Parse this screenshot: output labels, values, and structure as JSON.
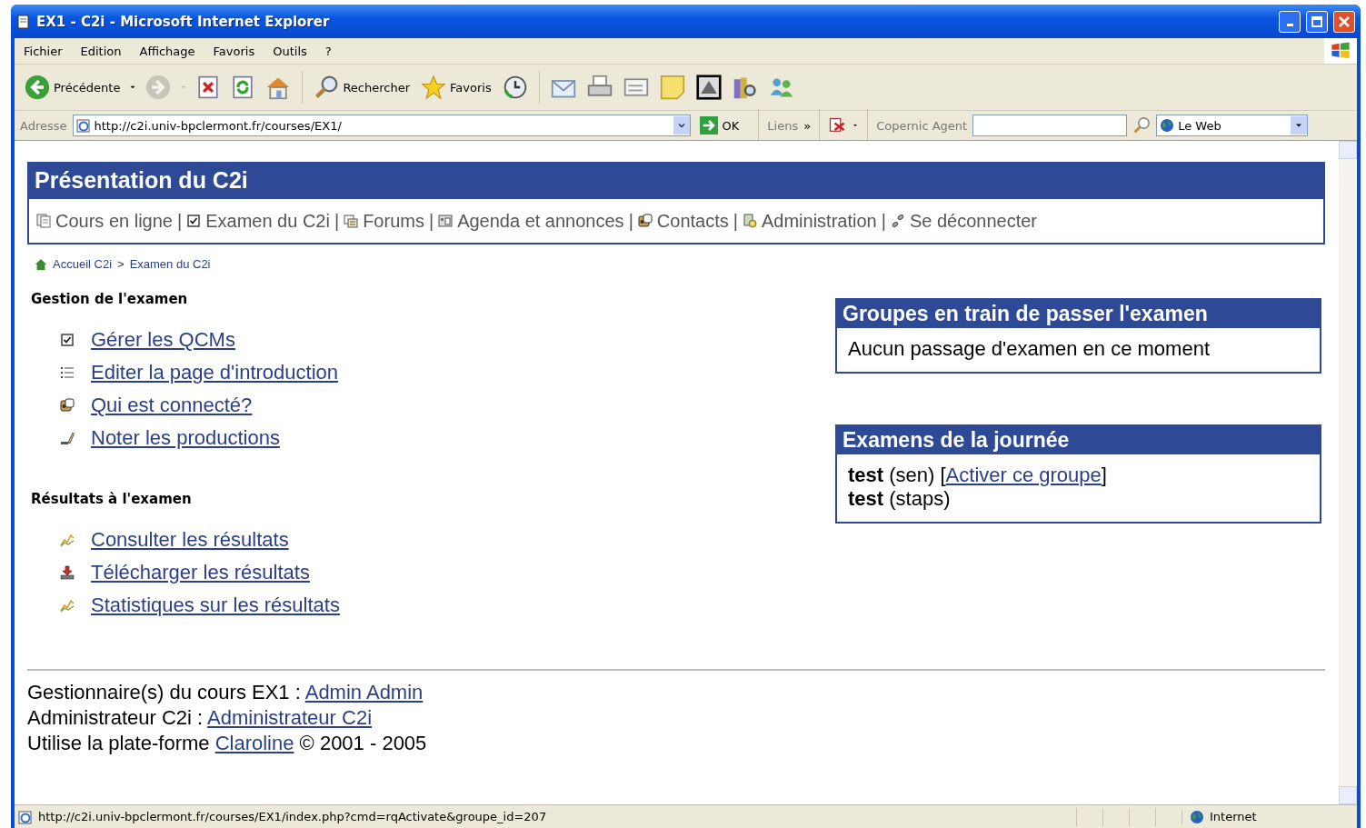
{
  "window": {
    "title": "EX1 - C2i - Microsoft Internet Explorer"
  },
  "menu": [
    "Fichier",
    "Edition",
    "Affichage",
    "Favoris",
    "Outils",
    "?"
  ],
  "toolbar": {
    "back_label": "Précédente",
    "forward": {
      "disabled": true
    },
    "search_label": "Rechercher",
    "favorites_label": "Favoris"
  },
  "address_bar": {
    "label": "Adresse",
    "url": "http://c2i.univ-bpclermont.fr/courses/EX1/",
    "go_label": "OK",
    "links_label": "Liens",
    "links_more": "»",
    "search_toolbar_label": "Copernic Agent",
    "search_scope": "Le Web"
  },
  "page": {
    "title": "Présentation du C2i",
    "separator": "|",
    "nav": [
      {
        "label": "Cours en ligne"
      },
      {
        "label": "Examen du C2i"
      },
      {
        "label": "Forums"
      },
      {
        "label": "Agenda et annonces"
      },
      {
        "label": "Contacts"
      },
      {
        "label": "Administration"
      },
      {
        "label": "Se déconnecter"
      }
    ],
    "breadcrumb": [
      {
        "label": "Accueil C2i"
      },
      {
        "label": "Examen du C2i"
      }
    ],
    "breadcrumb_separator": ">",
    "sections": [
      {
        "title": "Gestion de l'examen",
        "items": [
          {
            "label": "Gérer les QCMs"
          },
          {
            "label": "Editer la page d'introduction"
          },
          {
            "label": "Qui est connecté?"
          },
          {
            "label": "Noter les productions"
          }
        ]
      },
      {
        "title": "Résultats à l'examen",
        "items": [
          {
            "label": "Consulter les résultats"
          },
          {
            "label": "Télécharger les résultats"
          },
          {
            "label": "Statistiques sur les résultats"
          }
        ]
      }
    ],
    "panels": [
      {
        "kind": "message",
        "title": "Groupes en train de passer l'examen",
        "message": "Aucun passage d'examen en ce moment"
      },
      {
        "kind": "rows",
        "title": "Examens de la journée",
        "rows": [
          {
            "text": "**test** (sen) [",
            "link": "Activer ce groupe",
            "after": "]"
          },
          {
            "text": "**test** (staps)"
          }
        ]
      }
    ],
    "footer": [
      {
        "text": "Gestionnaire(s) du cours EX1 : ",
        "link": "Admin Admin"
      },
      {
        "text": "Administrateur C2i : ",
        "link": "Administrateur C2i"
      },
      {
        "text": "Utilise la plate-forme ",
        "link": "Claroline",
        "after": " © 2001 - 2005"
      }
    ]
  },
  "status_bar": {
    "url": "http://c2i.univ-bpclermont.fr/courses/EX1/index.php?cmd=rqActivate&groupe_id=207",
    "zone": "Internet"
  }
}
